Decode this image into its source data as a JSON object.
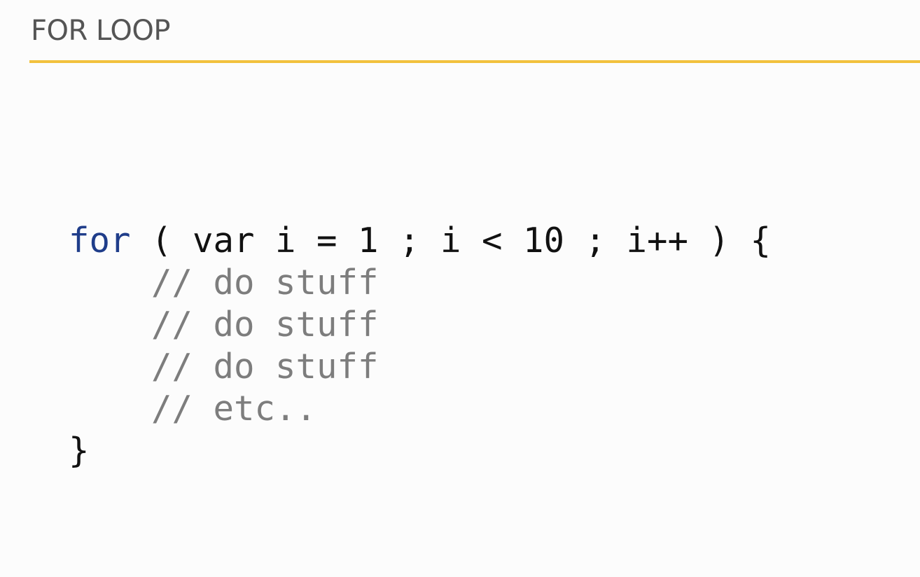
{
  "slide": {
    "title": "FOR LOOP"
  },
  "code": {
    "keyword": "for",
    "header_rest": " ( var i = 1 ; i < 10 ; i++ ) {",
    "indent": "    ",
    "comments": [
      "// do stuff",
      "// do stuff",
      "// do stuff",
      "// etc.."
    ],
    "closing": "}"
  },
  "colors": {
    "accent_rule": "#f2c13e",
    "keyword": "#1f3d8a",
    "comment": "#7d7d7d",
    "text": "#111111",
    "title": "#555555",
    "background": "#fcfcfc"
  }
}
